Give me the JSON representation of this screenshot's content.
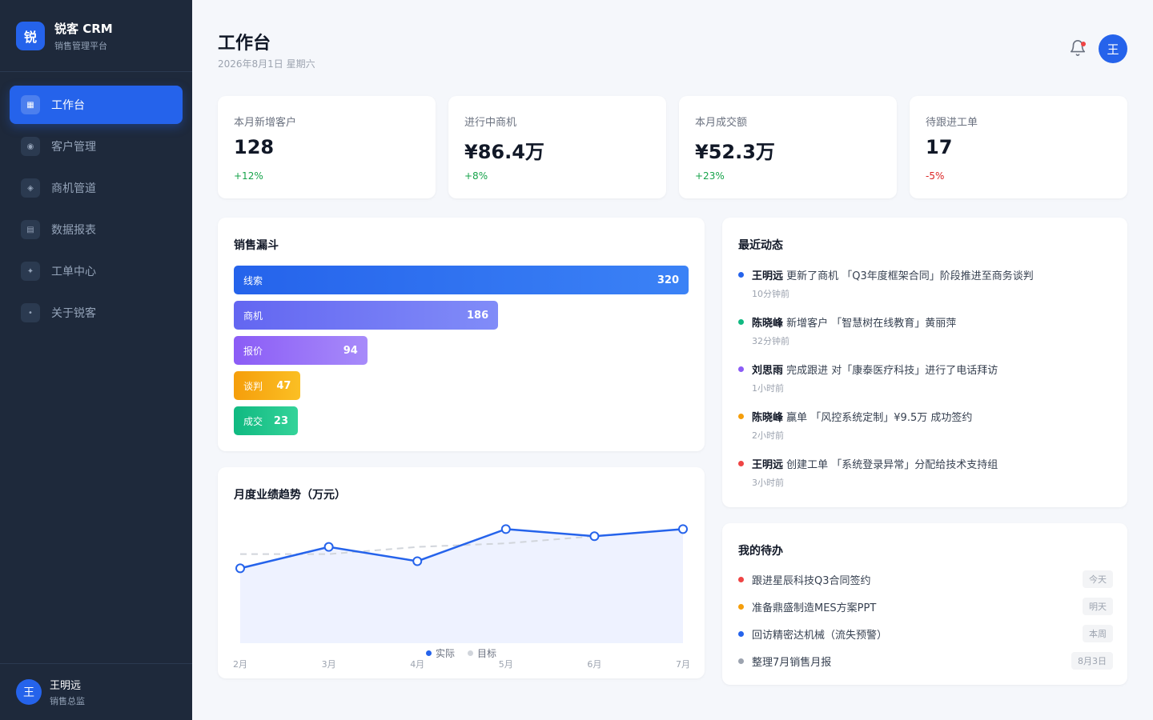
{
  "brand": {
    "logo": "锐",
    "name": "锐客 CRM",
    "subtitle": "销售管理平台"
  },
  "nav": [
    {
      "label": "工作台",
      "icon": "grid-icon",
      "glyph": "▦",
      "active": true
    },
    {
      "label": "客户管理",
      "icon": "customer-icon",
      "glyph": "◉",
      "active": false
    },
    {
      "label": "商机管道",
      "icon": "pipeline-icon",
      "glyph": "◈",
      "active": false
    },
    {
      "label": "数据报表",
      "icon": "report-icon",
      "glyph": "▤",
      "active": false
    },
    {
      "label": "工单中心",
      "icon": "ticket-icon",
      "glyph": "✦",
      "active": false
    },
    {
      "label": "关于锐客",
      "icon": "info-icon",
      "glyph": "•",
      "active": false
    }
  ],
  "user": {
    "avatar": "王",
    "name": "王明远",
    "role": "销售总监"
  },
  "header": {
    "title": "工作台",
    "date": "2026年8月1日 星期六",
    "avatar": "王"
  },
  "stats": [
    {
      "label": "本月新增客户",
      "value": "128",
      "change": "+12%",
      "trend": "up"
    },
    {
      "label": "进行中商机",
      "value": "¥86.4万",
      "change": "+8%",
      "trend": "up"
    },
    {
      "label": "本月成交额",
      "value": "¥52.3万",
      "change": "+23%",
      "trend": "up"
    },
    {
      "label": "待跟进工单",
      "value": "17",
      "change": "-5%",
      "trend": "down"
    }
  ],
  "funnel": {
    "title": "销售漏斗",
    "max": 320,
    "stages": [
      {
        "label": "线索",
        "value": 320,
        "from": "#2563eb",
        "to": "#3b82f6"
      },
      {
        "label": "商机",
        "value": 186,
        "from": "#6366f1",
        "to": "#818cf8"
      },
      {
        "label": "报价",
        "value": 94,
        "from": "#8b5cf6",
        "to": "#a78bfa"
      },
      {
        "label": "谈判",
        "value": 47,
        "from": "#f59e0b",
        "to": "#fbbf24"
      },
      {
        "label": "成交",
        "value": 23,
        "from": "#10b981",
        "to": "#34d399"
      }
    ]
  },
  "trend": {
    "title": "月度业绩趋势（万元）",
    "legend_actual": "实际",
    "legend_target": "目标"
  },
  "chart_data": {
    "type": "line",
    "categories": [
      "2月",
      "3月",
      "4月",
      "5月",
      "6月",
      "7月"
    ],
    "series": [
      {
        "name": "实际",
        "values": [
          41,
          47,
          43,
          52,
          50,
          52
        ],
        "color": "#2563eb"
      },
      {
        "name": "目标",
        "values": [
          45,
          45,
          47,
          48,
          50,
          52
        ],
        "color": "#d1d5db"
      }
    ],
    "ylim": [
      20,
      55
    ],
    "legend": "bottom"
  },
  "activity": {
    "title": "最近动态",
    "items": [
      {
        "who": "王明远",
        "text": " 更新了商机 「Q3年度框架合同」阶段推进至商务谈判",
        "time": "10分钟前",
        "color": "#2563eb"
      },
      {
        "who": "陈晓峰",
        "text": " 新增客户 「智慧树在线教育」黄丽萍",
        "time": "32分钟前",
        "color": "#10b981"
      },
      {
        "who": "刘思雨",
        "text": " 完成跟进 对「康泰医疗科技」进行了电话拜访",
        "time": "1小时前",
        "color": "#8b5cf6"
      },
      {
        "who": "陈晓峰",
        "text": " 赢单 「风控系统定制」¥9.5万 成功签约",
        "time": "2小时前",
        "color": "#f59e0b"
      },
      {
        "who": "王明远",
        "text": " 创建工单 「系统登录异常」分配给技术支持组",
        "time": "3小时前",
        "color": "#ef4444"
      }
    ]
  },
  "todo": {
    "title": "我的待办",
    "items": [
      {
        "text": "跟进星辰科技Q3合同签约",
        "due": "今天",
        "color": "#ef4444"
      },
      {
        "text": "准备鼎盛制造MES方案PPT",
        "due": "明天",
        "color": "#f59e0b"
      },
      {
        "text": "回访精密达机械（流失预警）",
        "due": "本周",
        "color": "#2563eb"
      },
      {
        "text": "整理7月销售月报",
        "due": "8月3日",
        "color": "#9ca3af"
      }
    ]
  }
}
